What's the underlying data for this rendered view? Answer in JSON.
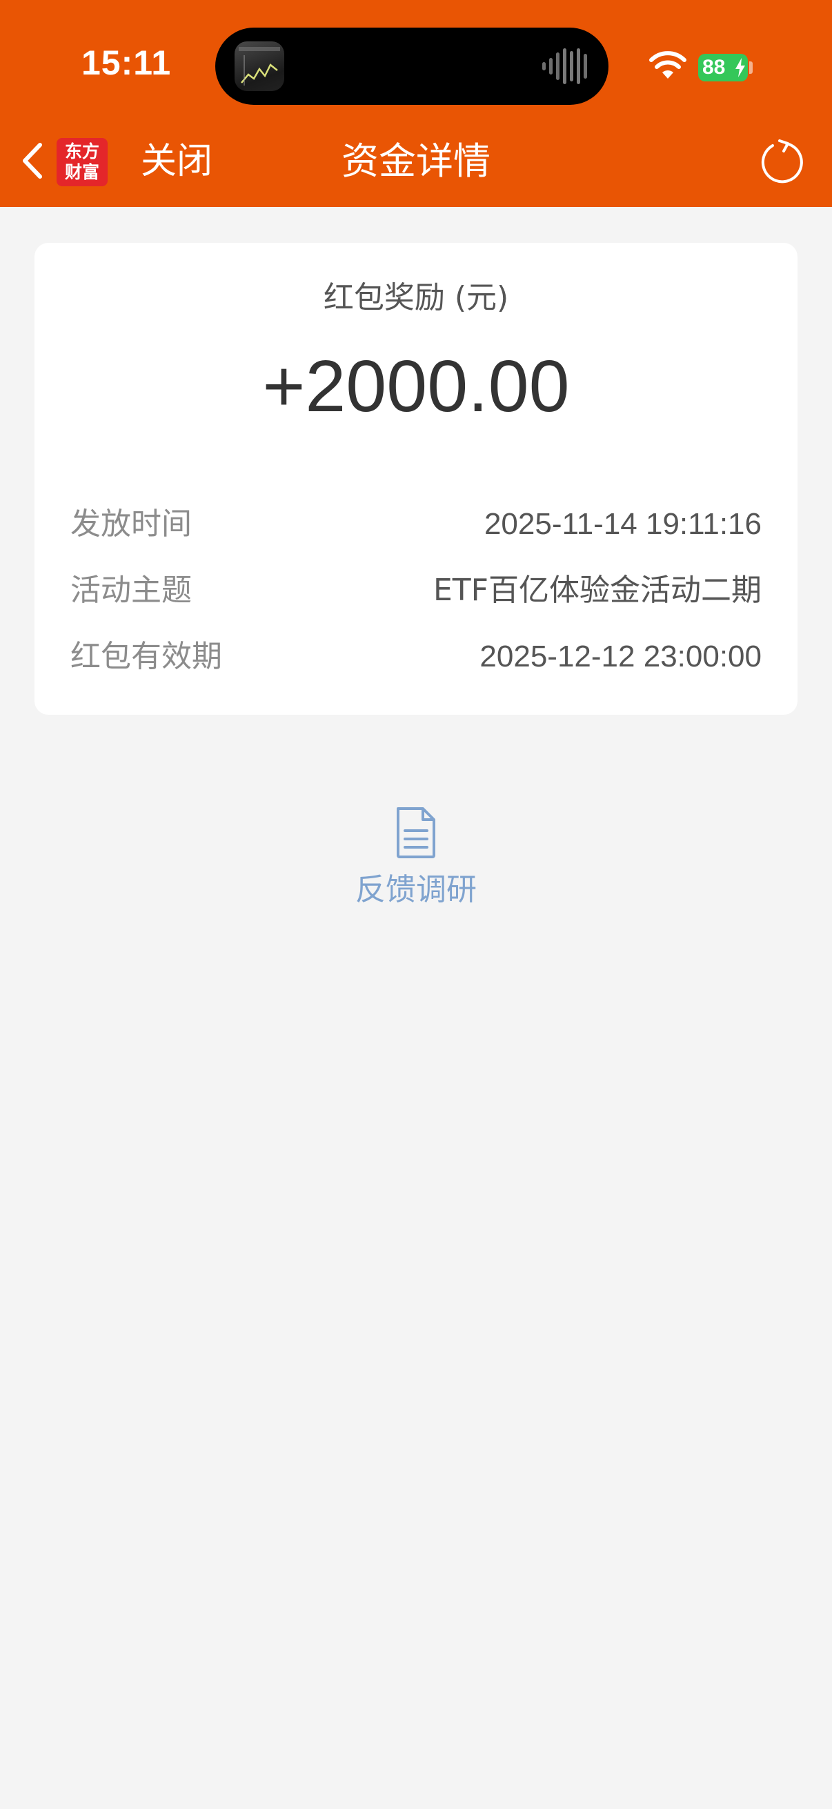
{
  "status_bar": {
    "time": "15:11",
    "battery_level": "88",
    "icons": [
      "now-playing-thumbnail-icon",
      "audio-waveform-icon",
      "wifi-icon",
      "battery-charging-icon"
    ]
  },
  "nav": {
    "back_icon": "chevron-left-icon",
    "logo_line1": "东方",
    "logo_line2": "财富",
    "close_label": "关闭",
    "title": "资金详情",
    "refresh_icon": "refresh-icon"
  },
  "card": {
    "amount_label": "红包奖励 (元)",
    "amount_value": "+2000.00",
    "rows": [
      {
        "label": "发放时间",
        "value": "2025-11-14 19:11:16"
      },
      {
        "label": "活动主题",
        "value": "ETF百亿体验金活动二期"
      },
      {
        "label": "红包有效期",
        "value": "2025-12-12 23:00:00"
      }
    ]
  },
  "feedback": {
    "icon": "document-icon",
    "label": "反馈调研"
  },
  "colors": {
    "header_bg": "#e95504",
    "page_bg": "#f4f4f4",
    "card_bg": "#ffffff",
    "link_blue": "#7fa3cf",
    "battery_green": "#34c759",
    "logo_red": "#e4262a"
  }
}
